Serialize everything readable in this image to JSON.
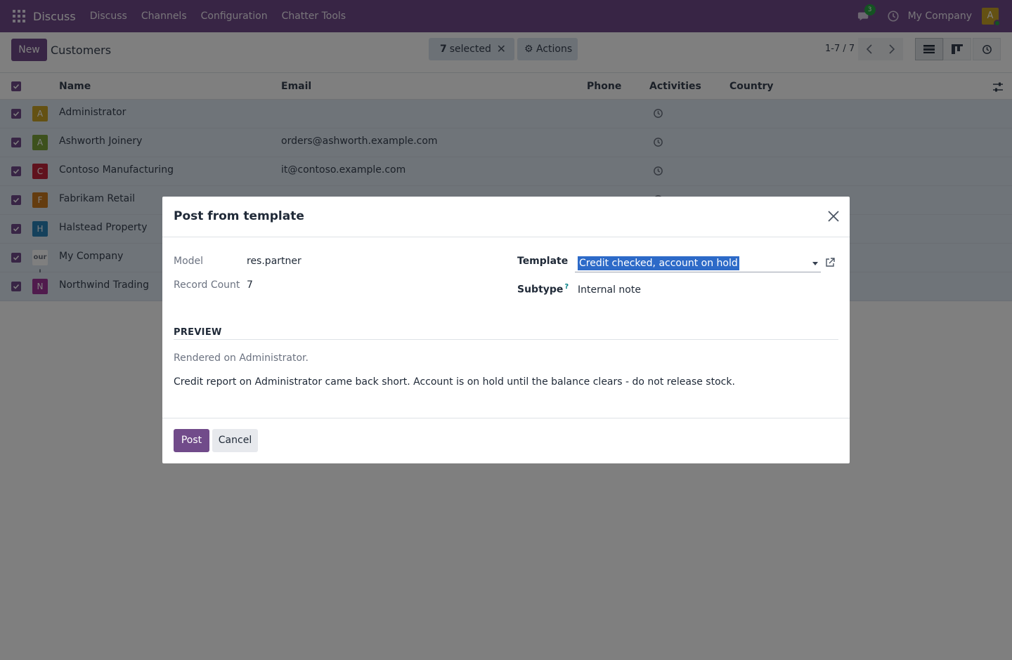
{
  "nav": {
    "brand": "Discuss",
    "menu": [
      "Discuss",
      "Channels",
      "Configuration",
      "Chatter Tools"
    ],
    "message_count": "3",
    "company": "My Company",
    "user_initial": "A"
  },
  "control": {
    "new_label": "New",
    "title": "Customers",
    "selected_count": "7",
    "selected_suffix": "selected",
    "actions_label": "Actions",
    "pager": "1-7 / 7"
  },
  "table": {
    "columns": {
      "name": "Name",
      "email": "Email",
      "phone": "Phone",
      "activities": "Activities",
      "country": "Country"
    },
    "rows": [
      {
        "initial": "A",
        "color": "#c9a227",
        "name": "Administrator",
        "email": ""
      },
      {
        "initial": "A",
        "color": "#7aa33a",
        "name": "Ashworth Joinery",
        "email": "orders@ashworth.example.com"
      },
      {
        "initial": "C",
        "color": "#c0243b",
        "name": "Contoso Manufacturing",
        "email": "it@contoso.example.com"
      },
      {
        "initial": "F",
        "color": "#c9781f",
        "name": "Fabrikam Retail",
        "email": ""
      },
      {
        "initial": "H",
        "color": "#2a83b8",
        "name": "Halstead Property",
        "email": ""
      },
      {
        "initial": "our l",
        "color": "#ffffff",
        "name": "My Company",
        "email": ""
      },
      {
        "initial": "N",
        "color": "#a0369a",
        "name": "Northwind Trading",
        "email": ""
      }
    ]
  },
  "modal": {
    "title": "Post from template",
    "model_label": "Model",
    "model_value": "res.partner",
    "record_count_label": "Record Count",
    "record_count_value": "7",
    "template_label": "Template",
    "template_value": "Credit checked, account on hold",
    "subtype_label": "Subtype",
    "subtype_help": "?",
    "subtype_value": "Internal note",
    "preview_title": "PREVIEW",
    "rendered_on": "Rendered on Administrator.",
    "preview_body": "Credit report on Administrator came back short. Account is on hold until the balance clears - do not release stock.",
    "post_label": "Post",
    "cancel_label": "Cancel"
  }
}
